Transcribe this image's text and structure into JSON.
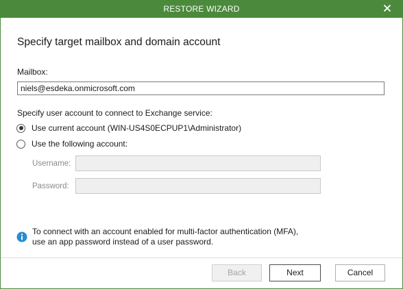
{
  "window": {
    "title": "RESTORE WIZARD",
    "accent_color": "#4b8a3c",
    "close_icon": "close-icon"
  },
  "page": {
    "heading": "Specify target mailbox and domain account"
  },
  "mailbox": {
    "label": "Mailbox:",
    "value": "niels@esdeka.onmicrosoft.com"
  },
  "account": {
    "section_label": "Specify user account to connect to Exchange service:",
    "option_current": "Use current account (WIN-US4S0ECPUP1\\Administrator)",
    "option_following": "Use the following account:",
    "selected": "current",
    "username_label": "Username:",
    "username_value": "",
    "password_label": "Password:",
    "password_value": ""
  },
  "info": {
    "icon": "info-icon",
    "line1": "To connect with an account enabled for multi-factor authentication (MFA),",
    "line2": "use an app password instead of a user password."
  },
  "buttons": {
    "back": "Back",
    "next": "Next",
    "cancel": "Cancel"
  }
}
